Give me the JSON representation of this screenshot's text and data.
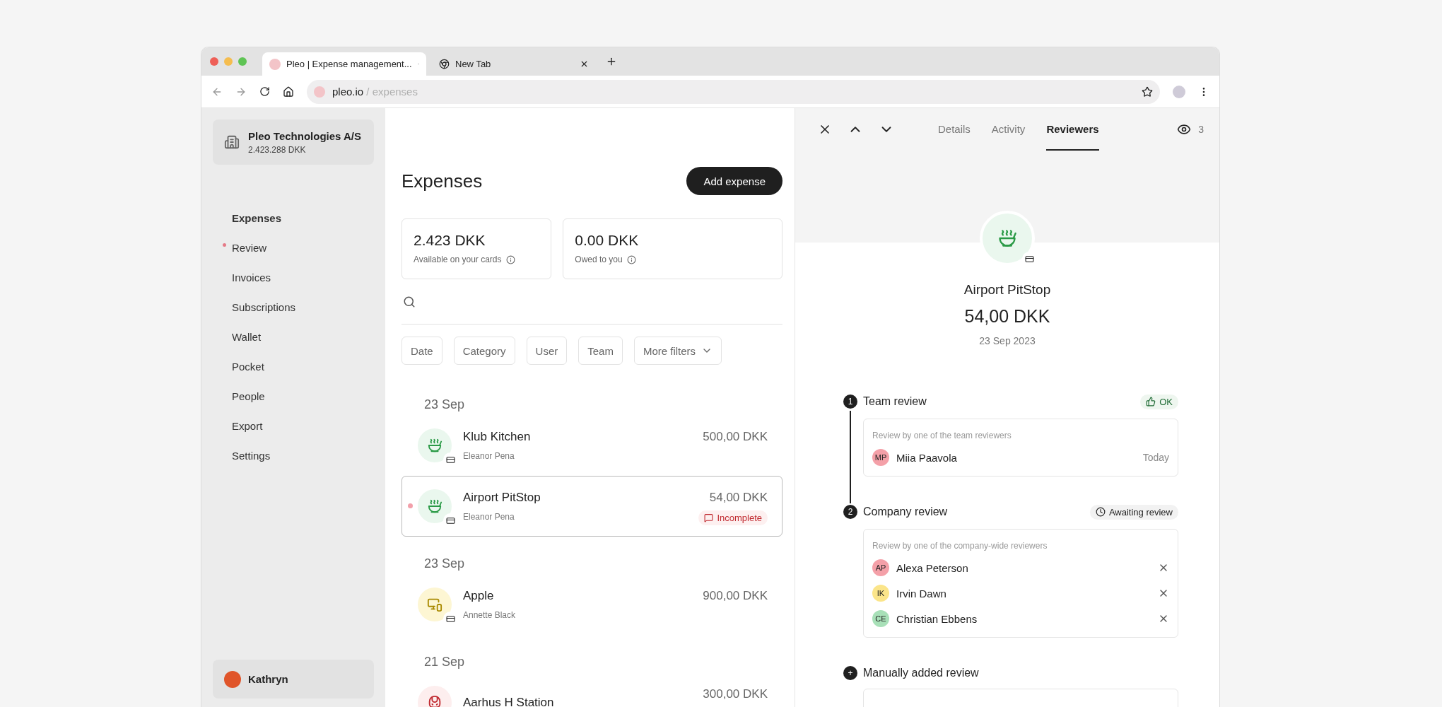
{
  "browser": {
    "tabs": [
      {
        "title": "Pleo | Expense management...",
        "selected": true
      },
      {
        "title": "New Tab",
        "selected": false
      }
    ],
    "url": {
      "domain": "pleo.io",
      "path": " / expenses"
    }
  },
  "sidebar": {
    "org": {
      "name": "Pleo Technologies A/S",
      "balance": "2.423.288 DKK"
    },
    "nav": [
      {
        "label": "Expenses",
        "selected": true,
        "attention": false
      },
      {
        "label": "Review",
        "selected": false,
        "attention": true
      },
      {
        "label": "Invoices",
        "selected": false,
        "attention": false
      },
      {
        "label": "Subscriptions",
        "selected": false,
        "attention": false
      },
      {
        "label": "Wallet",
        "selected": false,
        "attention": false
      },
      {
        "label": "Pocket",
        "selected": false,
        "attention": false
      },
      {
        "label": "People",
        "selected": false,
        "attention": false
      },
      {
        "label": "Export",
        "selected": false,
        "attention": false
      },
      {
        "label": "Settings",
        "selected": false,
        "attention": false
      }
    ],
    "user": {
      "name": "Kathryn"
    }
  },
  "expenses": {
    "title": "Expenses",
    "add_button": "Add expense",
    "stats": [
      {
        "value": "2.423 DKK",
        "label": "Available on your cards"
      },
      {
        "value": "0.00 DKK",
        "label": "Owed to you"
      }
    ],
    "filters": [
      {
        "label": "Date",
        "dropdown": false
      },
      {
        "label": "Category",
        "dropdown": false
      },
      {
        "label": "User",
        "dropdown": false
      },
      {
        "label": "Team",
        "dropdown": false
      },
      {
        "label": "More filters",
        "dropdown": true
      }
    ],
    "groups": [
      {
        "date": "23 Sep",
        "items": [
          {
            "kind": "food",
            "merchant": "Klub Kitchen",
            "user": "Eleanor Pena",
            "amount": "500,00 DKK",
            "selected": false,
            "unread": false
          },
          {
            "kind": "food",
            "merchant": "Airport PitStop",
            "user": "Eleanor Pena",
            "amount": "54,00 DKK",
            "status": "Incomplete",
            "selected": true,
            "unread": true
          }
        ]
      },
      {
        "date": "23 Sep",
        "items": [
          {
            "kind": "device",
            "merchant": "Apple",
            "user": "Annette Black",
            "amount": "900,00 DKK",
            "selected": false,
            "unread": false
          }
        ]
      },
      {
        "date": "21 Sep",
        "items": [
          {
            "kind": "transport",
            "merchant": "Aarhus H Station",
            "amount": "300,00 DKK",
            "selected": false,
            "unread": false
          }
        ]
      }
    ]
  },
  "detail": {
    "tabs": [
      {
        "label": "Details",
        "selected": false
      },
      {
        "label": "Activity",
        "selected": false
      },
      {
        "label": "Reviewers",
        "selected": true
      }
    ],
    "watchers": "3",
    "merchant": "Airport PitStop",
    "amount": "54,00 DKK",
    "date": "23 Sep 2023",
    "steps": [
      {
        "marker": "1",
        "title": "Team review",
        "completed": true,
        "badge": {
          "kind": "ok",
          "label": "OK"
        },
        "description": "Review by one of the team reviewers",
        "reviewers": [
          {
            "initials": "MP",
            "name": "Miia Paavola",
            "color": "#f4a0a8",
            "meta": "Today",
            "removable": false
          }
        ]
      },
      {
        "marker": "2",
        "title": "Company review",
        "completed": false,
        "badge": {
          "kind": "pending",
          "label": "Awaiting review"
        },
        "description": "Review by one of the company-wide reviewers",
        "reviewers": [
          {
            "initials": "AP",
            "name": "Alexa Peterson",
            "color": "#f4a0a8",
            "removable": true
          },
          {
            "initials": "IK",
            "name": "Irvin Dawn",
            "color": "#fbe58a",
            "removable": true
          },
          {
            "initials": "CE",
            "name": "Christian Ebbens",
            "color": "#a8e0b8",
            "removable": true
          }
        ]
      },
      {
        "marker": "+",
        "title": "Manually added review",
        "completed": false,
        "field": true
      }
    ]
  }
}
